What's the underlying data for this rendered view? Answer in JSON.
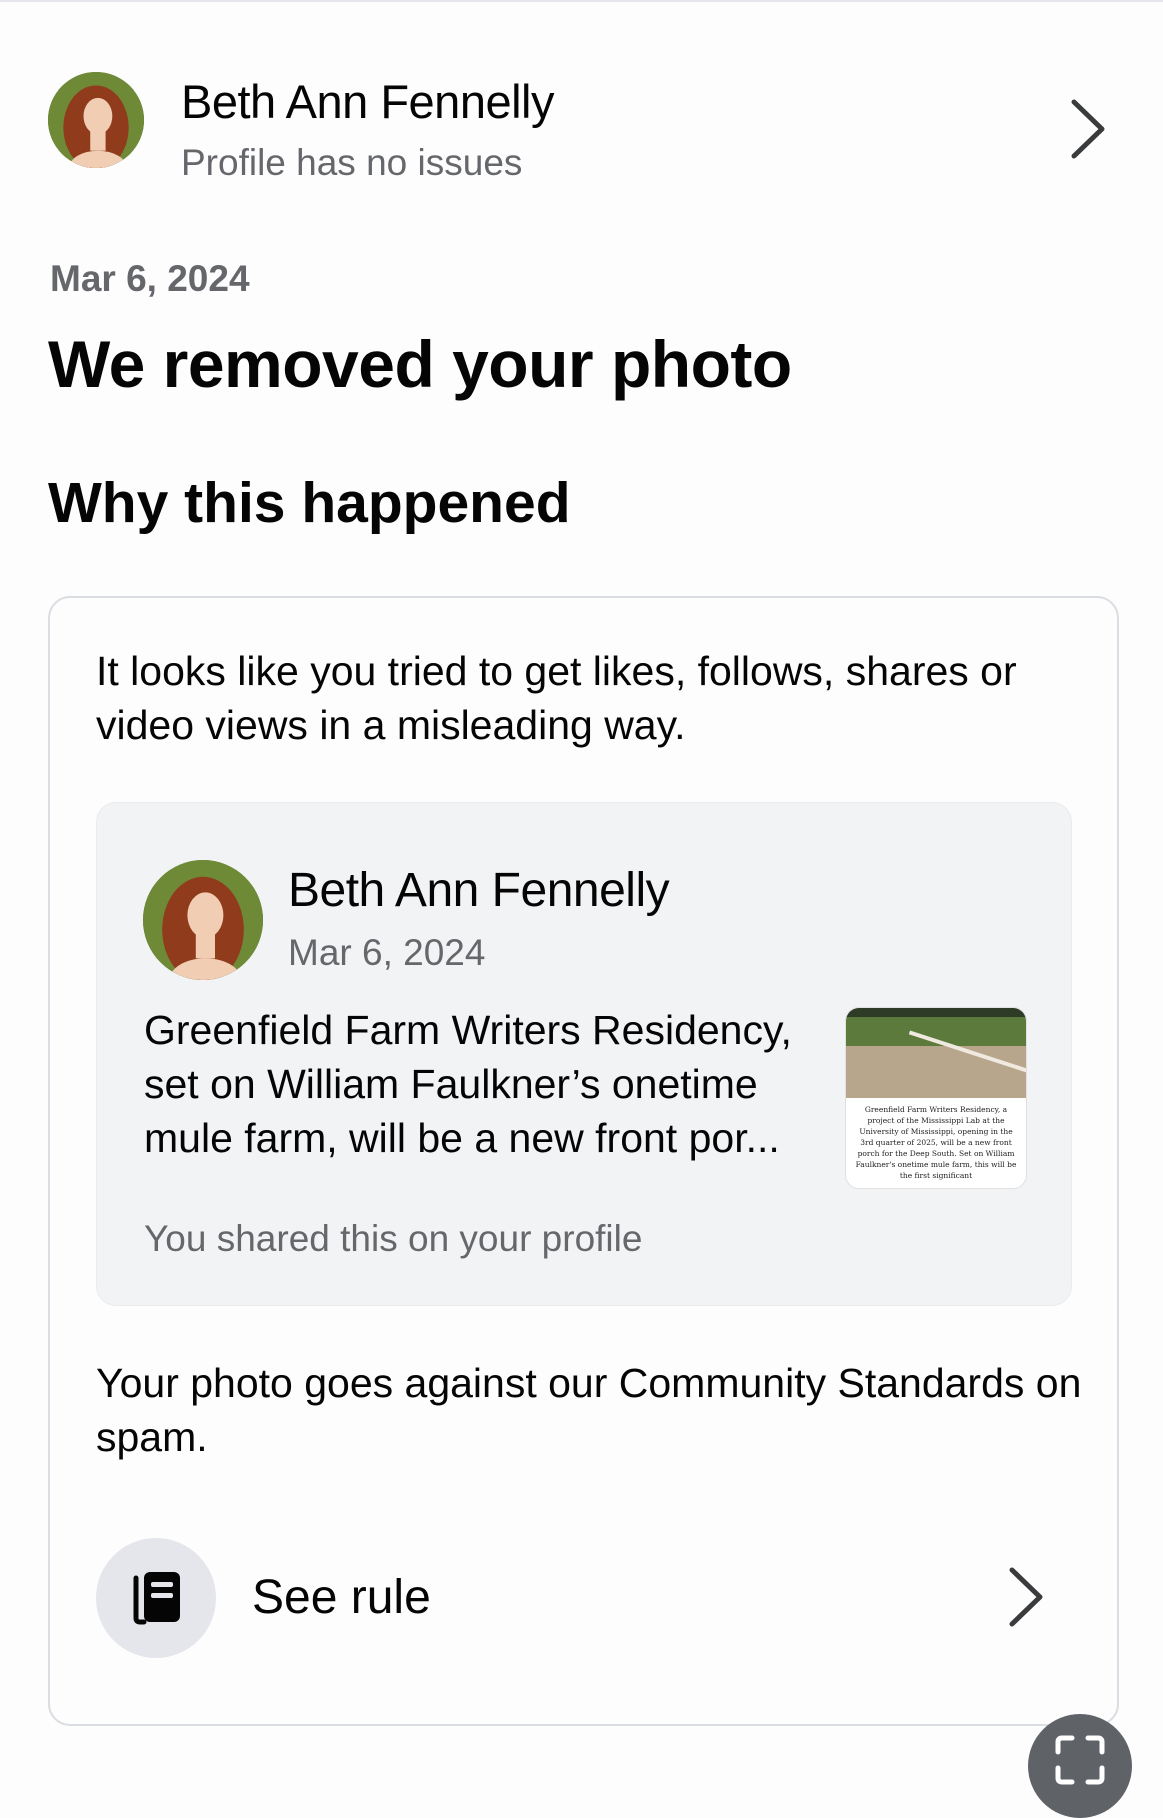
{
  "profile": {
    "name": "Beth Ann Fennelly",
    "status": "Profile has no issues"
  },
  "notice": {
    "date": "Mar 6, 2024",
    "title": "We removed your photo",
    "section_title": "Why this happened"
  },
  "card": {
    "reason": "It looks like you tried to get likes, follows, shares or video views in a misleading way.",
    "post": {
      "author": "Beth Ann Fennelly",
      "date": "Mar 6, 2024",
      "text": "Greenfield Farm Writers Residency, set on William Faulkner’s onetime mule farm, will be a new front por...",
      "thumbnail_caption": "Greenfield Farm Writers Residency, a project of the Mississippi Lab at the University of Mississippi, opening in the 3rd quarter of 2025, will be a new front porch for the Deep South. Set on William Faulkner's onetime mule farm, this will be the first significant",
      "shared_note": "You shared this on your profile"
    },
    "policy_text": "Your photo goes against our Community Standards on spam.",
    "see_rule_label": "See rule"
  },
  "icons": {
    "profile_chevron": "chevron-right-icon",
    "rule": "rule-book-icon",
    "rule_chevron": "chevron-right-icon",
    "fab": "scan-icon"
  }
}
